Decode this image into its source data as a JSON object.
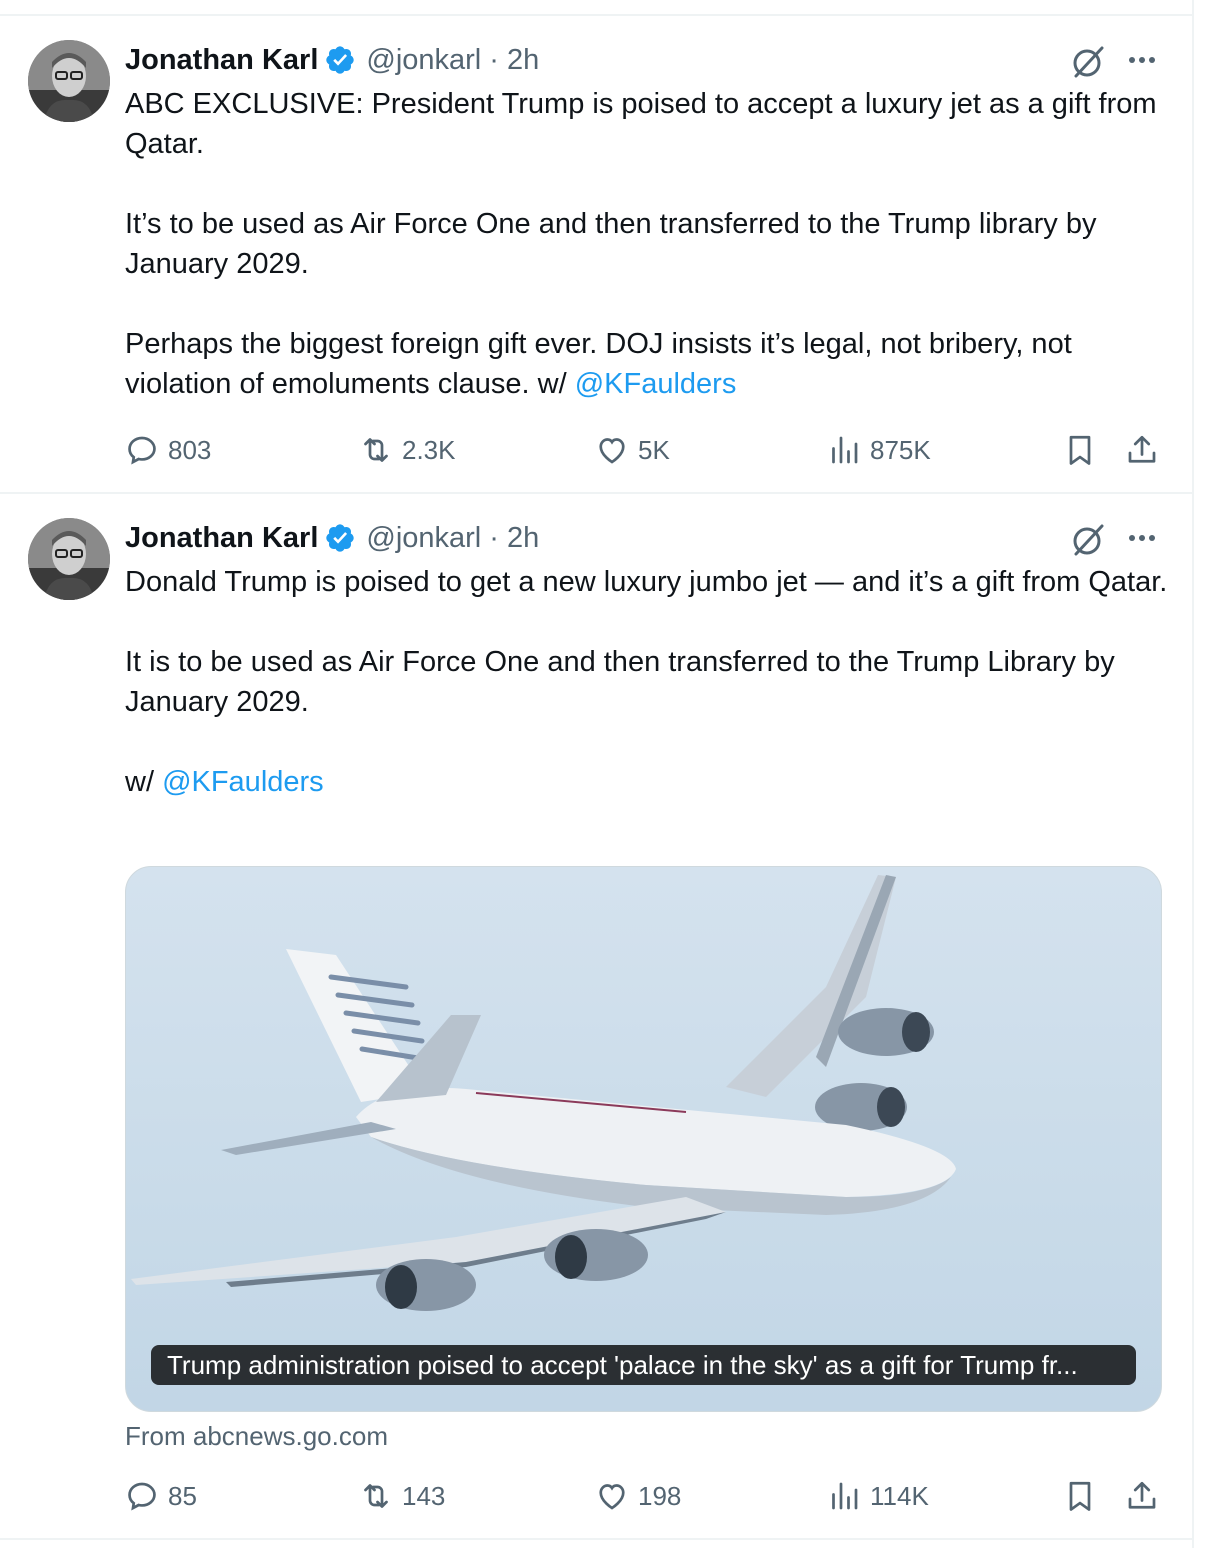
{
  "tweets": [
    {
      "author_name": "Jonathan Karl",
      "handle_time": "@jonkarl · 2h",
      "paragraphs": [
        "ABC EXCLUSIVE: President Trump is poised to accept a luxury jet as a gift from Qatar.",
        "It’s to be used as Air Force One and then transferred to the Trump library by January 2029.",
        "Perhaps the biggest foreign gift ever. DOJ insists it’s legal, not bribery, not violation of emoluments clause. w/ "
      ],
      "mention": "@KFaulders",
      "replies": "803",
      "reposts": "2.3K",
      "likes": "5K",
      "views": "875K"
    },
    {
      "author_name": "Jonathan Karl",
      "handle_time": "@jonkarl · 2h",
      "paragraphs": [
        "Donald Trump is poised to get a new luxury jumbo jet — and it’s a gift from Qatar.",
        "It is to be used as Air Force One and then transferred to the Trump Library by January 2029.",
        "w/ "
      ],
      "mention": "@KFaulders",
      "card_caption": "Trump administration poised to accept 'palace in the sky' as a gift for Trump fr...",
      "card_source": "From abcnews.go.com",
      "replies": "85",
      "reposts": "143",
      "likes": "198",
      "views": "114K"
    }
  ],
  "colors": {
    "accent": "#1d9bf0",
    "secondary_text": "#536471",
    "text": "#0f1419"
  },
  "icons": [
    "verified-badge-icon",
    "grok-icon",
    "more-icon",
    "reply-icon",
    "repost-icon",
    "like-icon",
    "views-icon",
    "bookmark-icon",
    "share-icon"
  ]
}
